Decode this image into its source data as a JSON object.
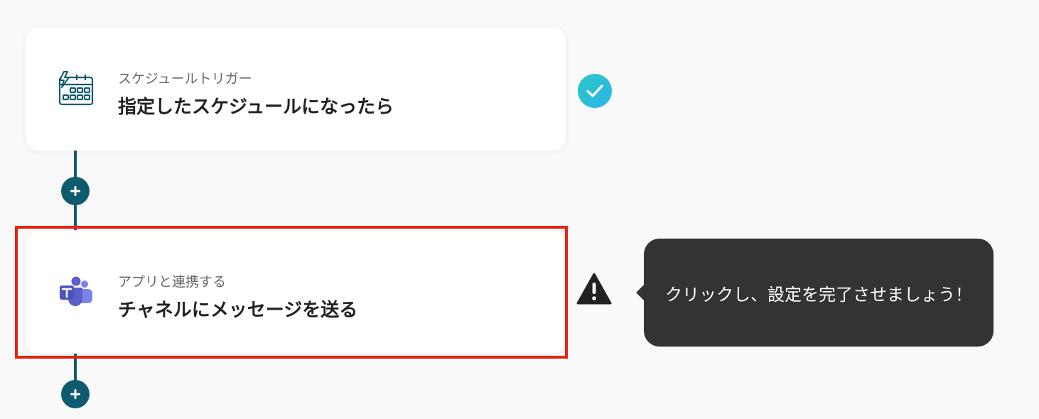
{
  "flow": {
    "steps": [
      {
        "subtitle": "スケジュールトリガー",
        "title": "指定したスケジュールになったら",
        "icon": "schedule-calendar-icon",
        "status": "completed",
        "status_icon": "check-circle-icon"
      },
      {
        "subtitle": "アプリと連携する",
        "title": "チャネルにメッセージを送る",
        "icon": "teams-icon",
        "status": "warning",
        "status_icon": "warning-triangle-icon"
      }
    ],
    "add_step_icon": "plus-icon"
  },
  "tooltip": {
    "text": "クリックし、設定を完了させましょう！"
  },
  "colors": {
    "background": "#f9f9f9",
    "connector": "#0e5a6e",
    "check_gradient_start": "#2ec6c9",
    "check_gradient_end": "#2ab6e6",
    "highlight_border": "#e8220f",
    "tooltip_bg": "#333333",
    "teams_purple": "#5b5fc7"
  }
}
